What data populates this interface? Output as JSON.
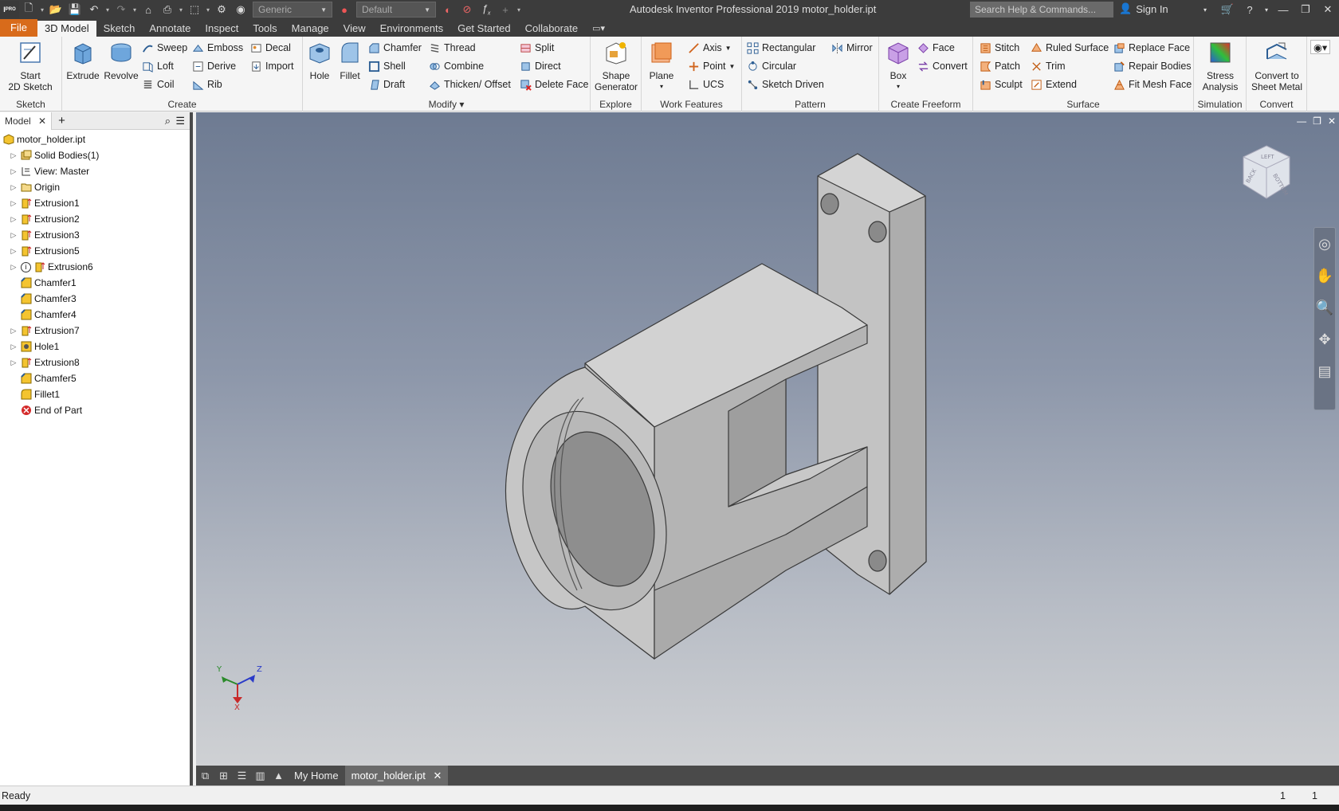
{
  "app": {
    "title": "Autodesk Inventor Professional 2019   motor_holder.ipt",
    "search_placeholder": "Search Help & Commands...",
    "sign_in": "Sign In",
    "material_value": "Generic",
    "appearance_value": "Default"
  },
  "tabs": [
    "File",
    "3D Model",
    "Sketch",
    "Annotate",
    "Inspect",
    "Tools",
    "Manage",
    "View",
    "Environments",
    "Get Started",
    "Collaborate"
  ],
  "active_tab": "3D Model",
  "ribbon": {
    "sketch": {
      "label": "Sketch",
      "start": "Start",
      "start2": "2D Sketch"
    },
    "create": {
      "label": "Create",
      "extrude": "Extrude",
      "revolve": "Revolve",
      "sweep": "Sweep",
      "loft": "Loft",
      "coil": "Coil",
      "emboss": "Emboss",
      "derive": "Derive",
      "rib": "Rib",
      "decal": "Decal",
      "import": "Import"
    },
    "modify": {
      "label": "Modify",
      "hole": "Hole",
      "fillet": "Fillet",
      "chamfer": "Chamfer",
      "shell": "Shell",
      "draft": "Draft",
      "thread": "Thread",
      "combine": "Combine",
      "thicken": "Thicken/ Offset",
      "split": "Split",
      "direct": "Direct",
      "delete_face": "Delete Face"
    },
    "explore": {
      "label": "Explore",
      "shape1": "Shape",
      "shape2": "Generator"
    },
    "work": {
      "label": "Work Features",
      "plane": "Plane",
      "axis": "Axis",
      "point": "Point",
      "ucs": "UCS"
    },
    "pattern": {
      "label": "Pattern",
      "rectangular": "Rectangular",
      "circular": "Circular",
      "sketch_driven": "Sketch Driven",
      "mirror": "Mirror"
    },
    "freeform": {
      "label": "Create Freeform",
      "box": "Box",
      "face": "Face",
      "convert": "Convert"
    },
    "surface": {
      "label": "Surface",
      "stitch": "Stitch",
      "patch": "Patch",
      "sculpt": "Sculpt",
      "ruled": "Ruled Surface",
      "trim": "Trim",
      "extend": "Extend",
      "replace": "Replace Face",
      "repair": "Repair Bodies",
      "fit_mesh": "Fit Mesh Face"
    },
    "simulation": {
      "label": "Simulation",
      "stress1": "Stress",
      "stress2": "Analysis"
    },
    "convertp": {
      "label": "Convert",
      "c1": "Convert to",
      "c2": "Sheet Metal"
    }
  },
  "browser": {
    "tab": "Model",
    "items": [
      {
        "label": "motor_holder.ipt",
        "expander": false,
        "icon": "part-icon",
        "indent": 0
      },
      {
        "label": "Solid Bodies(1)",
        "expander": true,
        "icon": "solid-bodies-icon",
        "indent": 1
      },
      {
        "label": "View: Master",
        "expander": true,
        "icon": "view-icon",
        "indent": 1
      },
      {
        "label": "Origin",
        "expander": true,
        "icon": "folder-icon",
        "indent": 1
      },
      {
        "label": "Extrusion1",
        "expander": true,
        "icon": "extrusion-icon",
        "indent": 1
      },
      {
        "label": "Extrusion2",
        "expander": true,
        "icon": "extrusion-icon",
        "indent": 1
      },
      {
        "label": "Extrusion3",
        "expander": true,
        "icon": "extrusion-icon",
        "indent": 1
      },
      {
        "label": "Extrusion5",
        "expander": true,
        "icon": "extrusion-icon",
        "indent": 1
      },
      {
        "label": "Extrusion6",
        "expander": true,
        "icon": "extrusion-warning-icon",
        "indent": 1
      },
      {
        "label": "Chamfer1",
        "expander": false,
        "icon": "chamfer-icon",
        "indent": 1
      },
      {
        "label": "Chamfer3",
        "expander": false,
        "icon": "chamfer-icon",
        "indent": 1
      },
      {
        "label": "Chamfer4",
        "expander": false,
        "icon": "chamfer-icon",
        "indent": 1
      },
      {
        "label": "Extrusion7",
        "expander": true,
        "icon": "extrusion-icon",
        "indent": 1
      },
      {
        "label": "Hole1",
        "expander": true,
        "icon": "hole-icon",
        "indent": 1
      },
      {
        "label": "Extrusion8",
        "expander": true,
        "icon": "extrusion-icon",
        "indent": 1
      },
      {
        "label": "Chamfer5",
        "expander": false,
        "icon": "chamfer-icon",
        "indent": 1
      },
      {
        "label": "Fillet1",
        "expander": false,
        "icon": "fillet-icon",
        "indent": 1
      },
      {
        "label": "End of Part",
        "expander": false,
        "icon": "end-of-part-icon",
        "indent": 1
      }
    ]
  },
  "doc_tabs": {
    "home": "My Home",
    "file": "motor_holder.ipt"
  },
  "viewcube": {
    "left": "LEFT",
    "back": "BACK",
    "bottom": "BOTTOM"
  },
  "triad": {
    "x": "X",
    "y": "Y",
    "z": "Z"
  },
  "status": {
    "text": "Ready",
    "n1": "1",
    "n2": "1"
  },
  "colors": {
    "accent": "#d86b1b",
    "titlebar": "#3c3c3c",
    "model": "#c8c8c8"
  }
}
